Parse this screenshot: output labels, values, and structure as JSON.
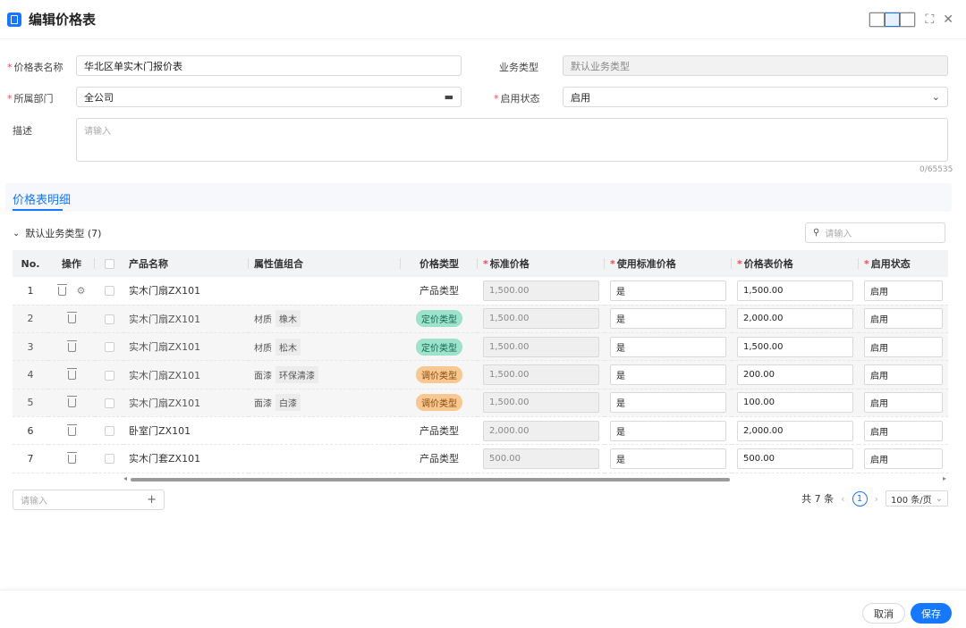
{
  "header": {
    "title": "编辑价格表"
  },
  "form": {
    "name_label": "价格表名称",
    "name_value": "华北区单实木门报价表",
    "biz_type_label": "业务类型",
    "biz_type_value": "默认业务类型",
    "dept_label": "所属部门",
    "dept_value": "全公司",
    "status_label": "启用状态",
    "status_value": "启用",
    "desc_label": "描述",
    "desc_placeholder": "请输入",
    "desc_counter": "0/65535"
  },
  "tabs": {
    "detail": "价格表明细"
  },
  "group": {
    "label": "默认业务类型 (7)",
    "search_placeholder": "请输入"
  },
  "table": {
    "headers": {
      "no": "No.",
      "op": "操作",
      "product": "产品名称",
      "attr": "属性值组合",
      "price_type": "价格类型",
      "std_price": "标准价格",
      "use_std": "使用标准价格",
      "list_price": "价格表价格",
      "status": "启用状态"
    },
    "rows": [
      {
        "no": "1",
        "product": "实木门扇ZX101",
        "attr_key": "",
        "attr_val": "",
        "price_type": "产品类型",
        "std_price": "1,500.00",
        "use_std": "是",
        "list_price": "1,500.00",
        "status": "启用"
      },
      {
        "no": "2",
        "product": "实木门扇ZX101",
        "attr_key": "材质",
        "attr_val": "橡木",
        "price_type": "定价类型",
        "std_price": "1,500.00",
        "use_std": "是",
        "list_price": "2,000.00",
        "status": "启用"
      },
      {
        "no": "3",
        "product": "实木门扇ZX101",
        "attr_key": "材质",
        "attr_val": "松木",
        "price_type": "定价类型",
        "std_price": "1,500.00",
        "use_std": "是",
        "list_price": "1,500.00",
        "status": "启用"
      },
      {
        "no": "4",
        "product": "实木门扇ZX101",
        "attr_key": "面漆",
        "attr_val": "环保清漆",
        "price_type": "调价类型",
        "std_price": "1,500.00",
        "use_std": "是",
        "list_price": "200.00",
        "status": "启用"
      },
      {
        "no": "5",
        "product": "实木门扇ZX101",
        "attr_key": "面漆",
        "attr_val": "白漆",
        "price_type": "调价类型",
        "std_price": "1,500.00",
        "use_std": "是",
        "list_price": "100.00",
        "status": "启用"
      },
      {
        "no": "6",
        "product": "卧室门ZX101",
        "attr_key": "",
        "attr_val": "",
        "price_type": "产品类型",
        "std_price": "2,000.00",
        "use_std": "是",
        "list_price": "2,000.00",
        "status": "启用"
      },
      {
        "no": "7",
        "product": "实木门套ZX101",
        "attr_key": "",
        "attr_val": "",
        "price_type": "产品类型",
        "std_price": "500.00",
        "use_std": "是",
        "list_price": "500.00",
        "status": "启用"
      }
    ]
  },
  "bottom": {
    "add_placeholder": "请输入",
    "total": "共 7 条",
    "page": "1",
    "page_size": "100 条/页"
  },
  "footer": {
    "cancel": "取消",
    "save": "保存"
  },
  "colors": {
    "primary": "#1677ff",
    "required": "#e34d59",
    "tag_green": "#9fe2cc",
    "tag_orange": "#f8c892"
  }
}
